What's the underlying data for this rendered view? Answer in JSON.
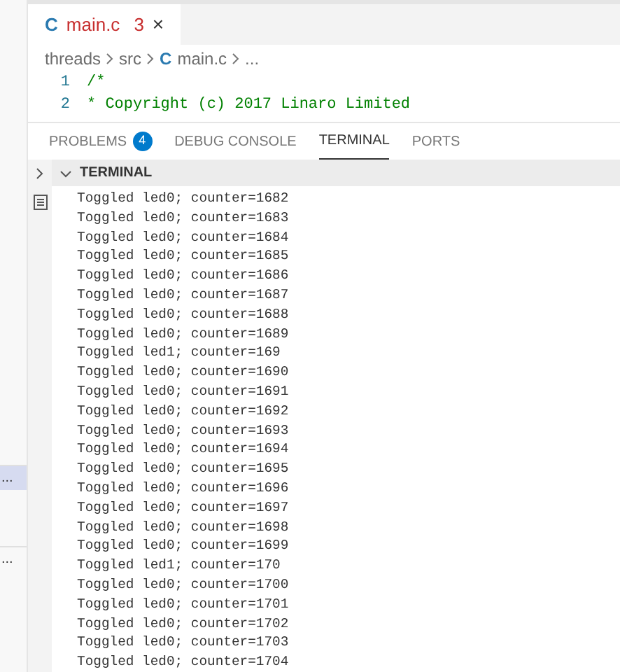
{
  "sidebar": {
    "items": [
      {
        "label": "...",
        "selected": true
      },
      {
        "label": "...",
        "selected": false
      }
    ]
  },
  "editor_tab": {
    "icon_letter": "C",
    "filename": "main.c",
    "problems": "3",
    "close": "×"
  },
  "breadcrumb": [
    "threads",
    "src",
    "main.c",
    "..."
  ],
  "breadcrumb_icon_letter": "C",
  "code_lines": [
    {
      "number": "1",
      "text": "/*"
    },
    {
      "number": "2",
      "text": "* Copyright (c) 2017 Linaro Limited"
    }
  ],
  "panel_tabs": [
    {
      "label": "PROBLEMS",
      "badge": "4",
      "selected": false
    },
    {
      "label": "DEBUG CONSOLE",
      "selected": false
    },
    {
      "label": "TERMINAL",
      "selected": true
    },
    {
      "label": "PORTS",
      "selected": false
    }
  ],
  "terminal": {
    "title": "TERMINAL",
    "expanded": true,
    "lines": [
      "Toggled led0; counter=1682",
      "Toggled led0; counter=1683",
      "Toggled led0; counter=1684",
      "Toggled led0; counter=1685",
      "Toggled led0; counter=1686",
      "Toggled led0; counter=1687",
      "Toggled led0; counter=1688",
      "Toggled led0; counter=1689",
      "Toggled led1; counter=169",
      "Toggled led0; counter=1690",
      "Toggled led0; counter=1691",
      "Toggled led0; counter=1692",
      "Toggled led0; counter=1693",
      "Toggled led0; counter=1694",
      "Toggled led0; counter=1695",
      "Toggled led0; counter=1696",
      "Toggled led0; counter=1697",
      "Toggled led0; counter=1698",
      "Toggled led0; counter=1699",
      "Toggled led1; counter=170",
      "Toggled led0; counter=1700",
      "Toggled led0; counter=1701",
      "Toggled led0; counter=1702",
      "Toggled led0; counter=1703",
      "Toggled led0; counter=1704"
    ]
  }
}
